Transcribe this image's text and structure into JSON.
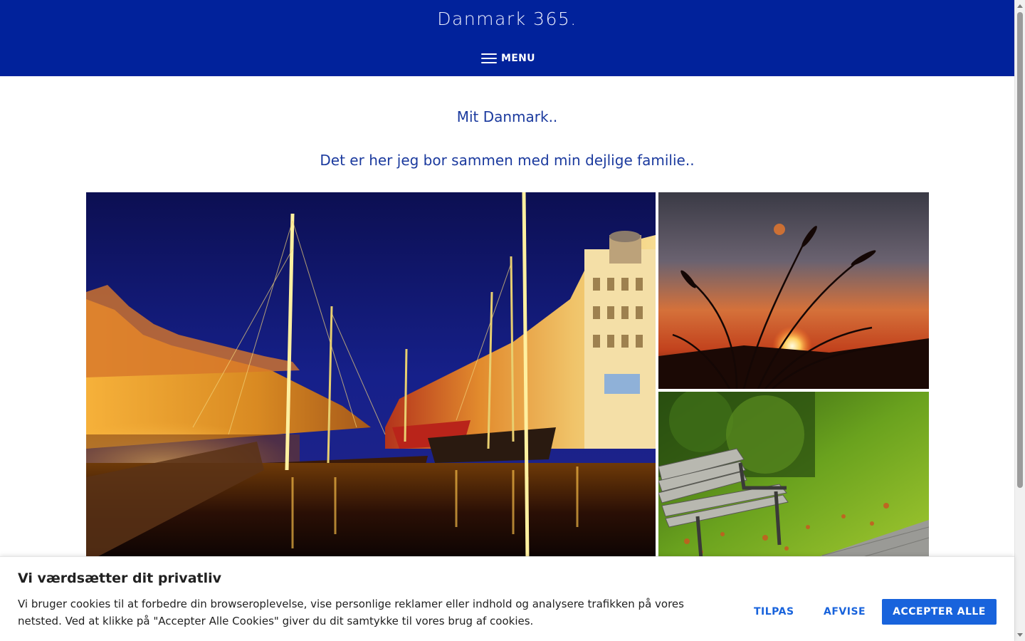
{
  "header": {
    "site_title": "Danmark 365.",
    "menu_label": "MENU",
    "background_color": "#01229b"
  },
  "content": {
    "intro_line_1": "Mit Danmark..",
    "intro_line_2": "Det er her jeg bor sammen med min dejlige familie..",
    "text_color": "#1b3a9e"
  },
  "gallery": {
    "images": [
      {
        "name": "nyhavn-night-photo"
      },
      {
        "name": "sunset-grass-photo"
      },
      {
        "name": "park-bench-photo"
      }
    ]
  },
  "cookie_banner": {
    "title": "Vi værdsætter dit privatliv",
    "text": "Vi bruger cookies til at forbedre din browseroplevelse, vise personlige reklamer eller indhold og analysere trafikken på vores netsted. Ved at klikke på \"Accepter Alle Cookies\" giver du dit samtykke til vores brug af cookies.",
    "customize_label": "TILPAS",
    "reject_label": "AFVISE",
    "accept_label": "ACCEPTER ALLE",
    "accent_color": "#1863dc"
  }
}
